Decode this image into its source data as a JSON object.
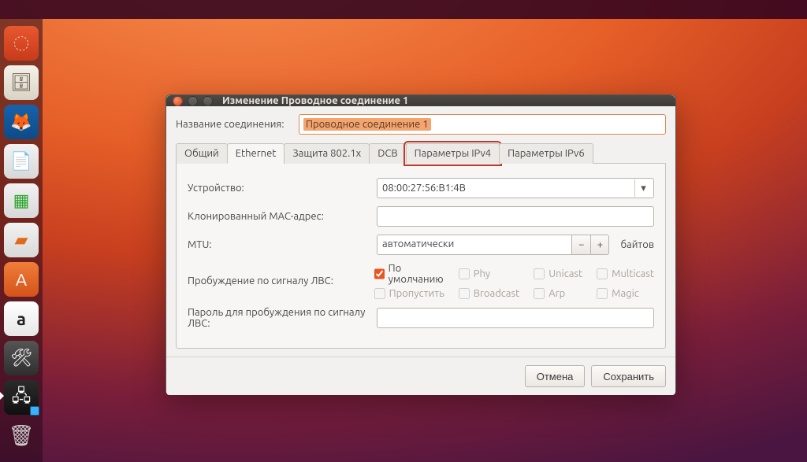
{
  "launcher": {
    "items": [
      {
        "name": "ubuntu-dash",
        "glyph": "◌"
      },
      {
        "name": "files",
        "glyph": "🗄"
      },
      {
        "name": "firefox",
        "glyph": "🦊"
      },
      {
        "name": "writer",
        "glyph": "📄"
      },
      {
        "name": "calc",
        "glyph": "▦"
      },
      {
        "name": "impress",
        "glyph": "▰"
      },
      {
        "name": "software",
        "glyph": "A"
      },
      {
        "name": "amazon",
        "glyph": "a"
      },
      {
        "name": "settings",
        "glyph": "🛠"
      },
      {
        "name": "network",
        "glyph": "🖧"
      }
    ],
    "trash_glyph": "🗑"
  },
  "window": {
    "title": "Изменение Проводное соединение 1",
    "conn_label": "Название соединения:",
    "conn_value": "Проводное соединение 1"
  },
  "tabs": {
    "general": "Общий",
    "ethernet": "Ethernet",
    "security": "Защита 802.1x",
    "dcb": "DCB",
    "ipv4": "Параметры IPv4",
    "ipv6": "Параметры IPv6"
  },
  "ethernet": {
    "device_label": "Устройство:",
    "device_value": "08:00:27:56:B1:4B",
    "cloned_mac_label": "Клонированный MAC-адрес:",
    "mtu_label": "MTU:",
    "mtu_value": "автоматически",
    "mtu_unit": "байтов",
    "wol_label": "Пробуждение по сигналу ЛВС:",
    "wol_password_label": "Пароль для пробуждения по сигналу ЛВС:",
    "checks": {
      "default": "По умолчанию",
      "phy": "Phy",
      "unicast": "Unicast",
      "multicast": "Multicast",
      "ignore": "Пропустить",
      "broadcast": "Broadcast",
      "arp": "Arp",
      "magic": "Magic"
    }
  },
  "footer": {
    "cancel": "Отмена",
    "save": "Сохранить"
  }
}
